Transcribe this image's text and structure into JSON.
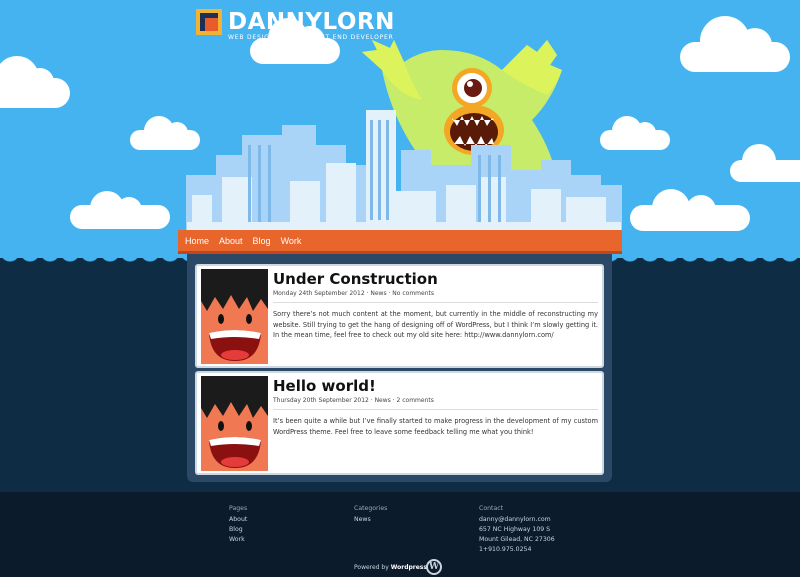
{
  "logo": {
    "name": "DANNYLORN",
    "tagline": "WEB DESIGNER AND FRONT END DEVELOPER"
  },
  "nav": [
    "Home",
    "About",
    "Blog",
    "Work"
  ],
  "posts": [
    {
      "title": "Under Construction",
      "meta": "Monday 24th September 2012 · News · No comments",
      "text": "Sorry there’s not much content at the moment, but currently in the middle of reconstructing my website.  Still trying to get the hang of designing off of WordPress, but I think I’m slowly getting it.   In the mean time, feel free to check out my old site here: http://www.dannylorn.com/"
    },
    {
      "title": "Hello world!",
      "meta": "Thursday 20th September 2012 · News · 2 comments",
      "text": "It’s been quite a while but I’ve finally started to make progress in the development of my custom WordPress theme. Feel free to leave some feedback telling me what you think!"
    }
  ],
  "footer": {
    "pages": {
      "title": "Pages",
      "items": [
        "About",
        "Blog",
        "Work"
      ]
    },
    "categories": {
      "title": "Categories",
      "items": [
        "News"
      ]
    },
    "contact": {
      "title": "Contact",
      "items": [
        "danny@dannylorn.com",
        "657 NC Highway 109 S",
        "Mount Gilead, NC 27306",
        "1+910.975.0254"
      ]
    },
    "powered_prefix": "Powered by",
    "powered_name": "Wordpress",
    "wp_letter": "W"
  },
  "colors": {
    "sky": "#46b3f1",
    "nav": "#e8652b",
    "water": "#0f2c45",
    "footer": "#0b1b2b",
    "monster": "#c6ec6a"
  }
}
